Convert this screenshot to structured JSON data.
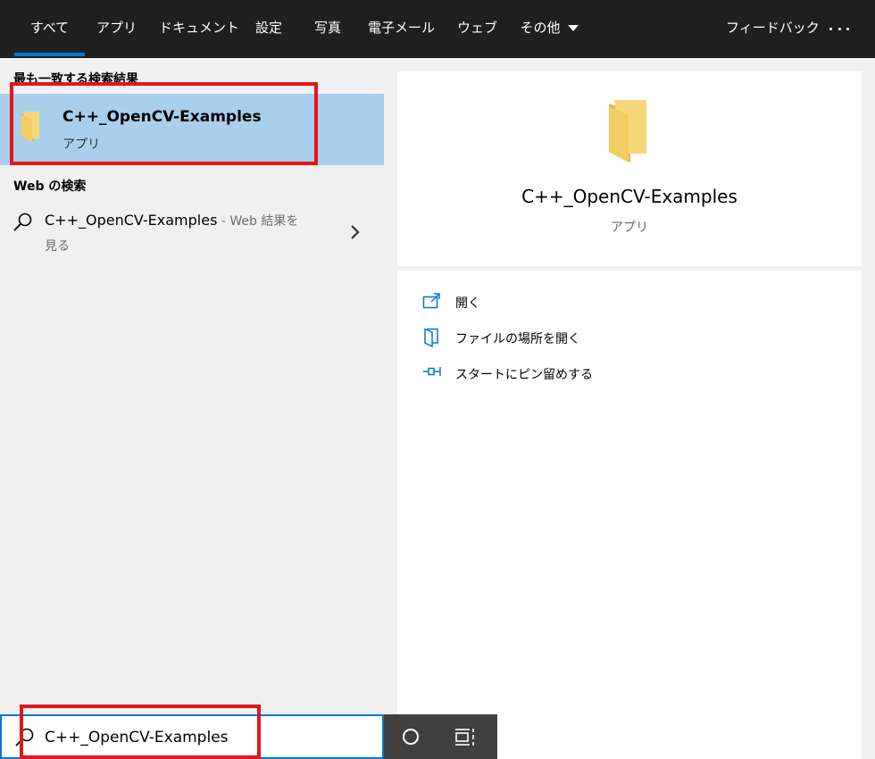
{
  "tabs": [
    {
      "label": "すべて",
      "active": true
    },
    {
      "label": "アプリ"
    },
    {
      "label": "ドキュメント"
    },
    {
      "label": "設定"
    },
    {
      "label": "写真"
    },
    {
      "label": "電子メール"
    },
    {
      "label": "ウェブ"
    },
    {
      "label": "その他"
    }
  ],
  "feedback_label": "フィードバック",
  "results": {
    "best_match_heading": "最も一致する検索結果",
    "best_match": {
      "title": "C++_OpenCV-Examples",
      "subtitle": "アプリ"
    },
    "web_heading": "Web の検索",
    "web_result": {
      "query": "C++_OpenCV-Examples",
      "suffix": " - Web 結果を",
      "line2": "見る"
    }
  },
  "detail": {
    "title": "C++_OpenCV-Examples",
    "subtitle": "アプリ",
    "actions": [
      {
        "label": "開く",
        "icon": "open-icon"
      },
      {
        "label": "ファイルの場所を開く",
        "icon": "file-location-icon"
      },
      {
        "label": "スタートにピン留めする",
        "icon": "pin-icon"
      }
    ]
  },
  "search_box": {
    "value": "C++_OpenCV-Examples"
  },
  "colors": {
    "accent": "#0078d7",
    "selection": "#aacfeb",
    "topbar": "#1f1f1f",
    "highlight_box": "#e0161b",
    "folder": "#f5d77a"
  }
}
